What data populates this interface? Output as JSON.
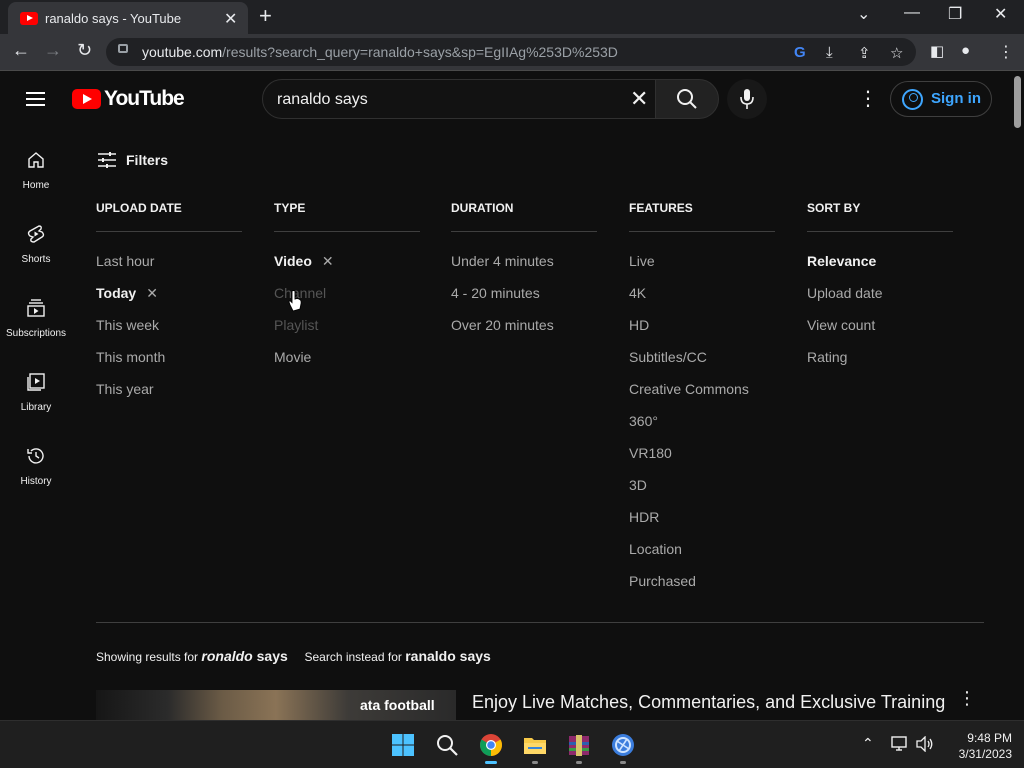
{
  "browser": {
    "tab_title": "ranaldo says - YouTube",
    "url_host": "youtube.com",
    "url_rest": "/results?search_query=ranaldo+says&sp=EgIIAg%253D%253D"
  },
  "youtube": {
    "logo_text": "YouTube",
    "search_value": "ranaldo says",
    "signin_label": "Sign in"
  },
  "guide": [
    {
      "label": "Home",
      "icon": "home-icon"
    },
    {
      "label": "Shorts",
      "icon": "shorts-icon"
    },
    {
      "label": "Subscriptions",
      "icon": "subscriptions-icon"
    },
    {
      "label": "Library",
      "icon": "library-icon"
    },
    {
      "label": "History",
      "icon": "history-icon"
    }
  ],
  "filters": {
    "label": "Filters",
    "columns": [
      {
        "title": "UPLOAD DATE",
        "options": [
          {
            "label": "Last hour",
            "state": "normal"
          },
          {
            "label": "Today",
            "state": "active"
          },
          {
            "label": "This week",
            "state": "normal"
          },
          {
            "label": "This month",
            "state": "normal"
          },
          {
            "label": "This year",
            "state": "normal"
          }
        ]
      },
      {
        "title": "TYPE",
        "options": [
          {
            "label": "Video",
            "state": "active"
          },
          {
            "label": "Channel",
            "state": "dim"
          },
          {
            "label": "Playlist",
            "state": "dim"
          },
          {
            "label": "Movie",
            "state": "normal"
          }
        ]
      },
      {
        "title": "DURATION",
        "options": [
          {
            "label": "Under 4 minutes",
            "state": "normal"
          },
          {
            "label": "4 - 20 minutes",
            "state": "normal"
          },
          {
            "label": "Over 20 minutes",
            "state": "normal"
          }
        ]
      },
      {
        "title": "FEATURES",
        "options": [
          {
            "label": "Live",
            "state": "normal"
          },
          {
            "label": "4K",
            "state": "normal"
          },
          {
            "label": "HD",
            "state": "normal"
          },
          {
            "label": "Subtitles/CC",
            "state": "normal"
          },
          {
            "label": "Creative Commons",
            "state": "normal"
          },
          {
            "label": "360°",
            "state": "normal"
          },
          {
            "label": "VR180",
            "state": "normal"
          },
          {
            "label": "3D",
            "state": "normal"
          },
          {
            "label": "HDR",
            "state": "normal"
          },
          {
            "label": "Location",
            "state": "normal"
          },
          {
            "label": "Purchased",
            "state": "normal"
          }
        ]
      },
      {
        "title": "SORT BY",
        "options": [
          {
            "label": "Relevance",
            "state": "active-sort"
          },
          {
            "label": "Upload date",
            "state": "normal"
          },
          {
            "label": "View count",
            "state": "normal"
          },
          {
            "label": "Rating",
            "state": "normal"
          }
        ]
      }
    ]
  },
  "correction": {
    "showing_prefix": "Showing results for",
    "corrected_italic": "ronaldo",
    "corrected_rest": " says",
    "instead_prefix": "Search instead for",
    "original_query": "ranaldo says"
  },
  "result": {
    "thumb_text": "ata football",
    "title": "Enjoy Live Matches, Commentaries, and Exclusive Training"
  },
  "taskbar": {
    "time": "9:48 PM",
    "date": "3/31/2023"
  }
}
